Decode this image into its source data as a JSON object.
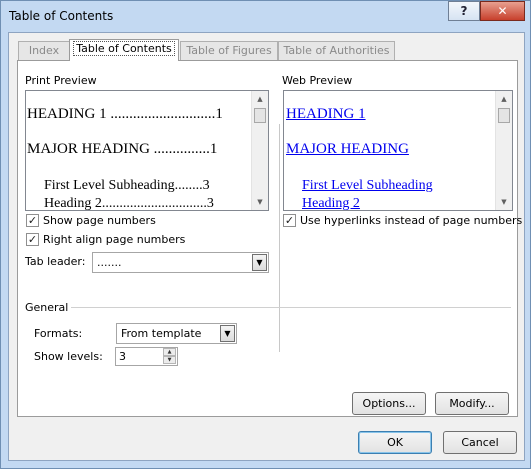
{
  "window": {
    "title": "Table of Contents",
    "help_label": "?",
    "close_label": "✕"
  },
  "tabs": [
    {
      "label": "Index"
    },
    {
      "label": "Table of Contents"
    },
    {
      "label": "Table of Figures"
    },
    {
      "label": "Table of Authorities"
    }
  ],
  "print_preview": {
    "label": "Print Preview",
    "entries": [
      {
        "text": "HEADING 1 ............................1"
      },
      {
        "text": "MAJOR HEADING ...............1"
      },
      {
        "text": "First Level Subheading........3"
      },
      {
        "text": "Heading 2..............................3"
      }
    ]
  },
  "web_preview": {
    "label": "Web Preview",
    "entries": [
      {
        "text": "HEADING 1"
      },
      {
        "text": "MAJOR HEADING"
      },
      {
        "text": "First Level Subheading"
      },
      {
        "text": "Heading 2"
      }
    ]
  },
  "options": {
    "show_page_numbers": {
      "label": "Show page numbers",
      "checked": true
    },
    "right_align": {
      "label": "Right align page numbers",
      "checked": true
    },
    "tab_leader": {
      "label": "Tab leader:",
      "value": "......."
    },
    "use_hyperlinks": {
      "label": "Use hyperlinks instead of page numbers",
      "checked": true
    }
  },
  "general": {
    "label": "General",
    "formats": {
      "label": "Formats:",
      "value": "From template"
    },
    "show_levels": {
      "label": "Show levels:",
      "value": "3"
    }
  },
  "buttons": {
    "options": "Options...",
    "modify": "Modify...",
    "ok": "OK",
    "cancel": "Cancel"
  },
  "colors": {
    "link": "#0000ee",
    "accent": "#3c7fb1"
  }
}
